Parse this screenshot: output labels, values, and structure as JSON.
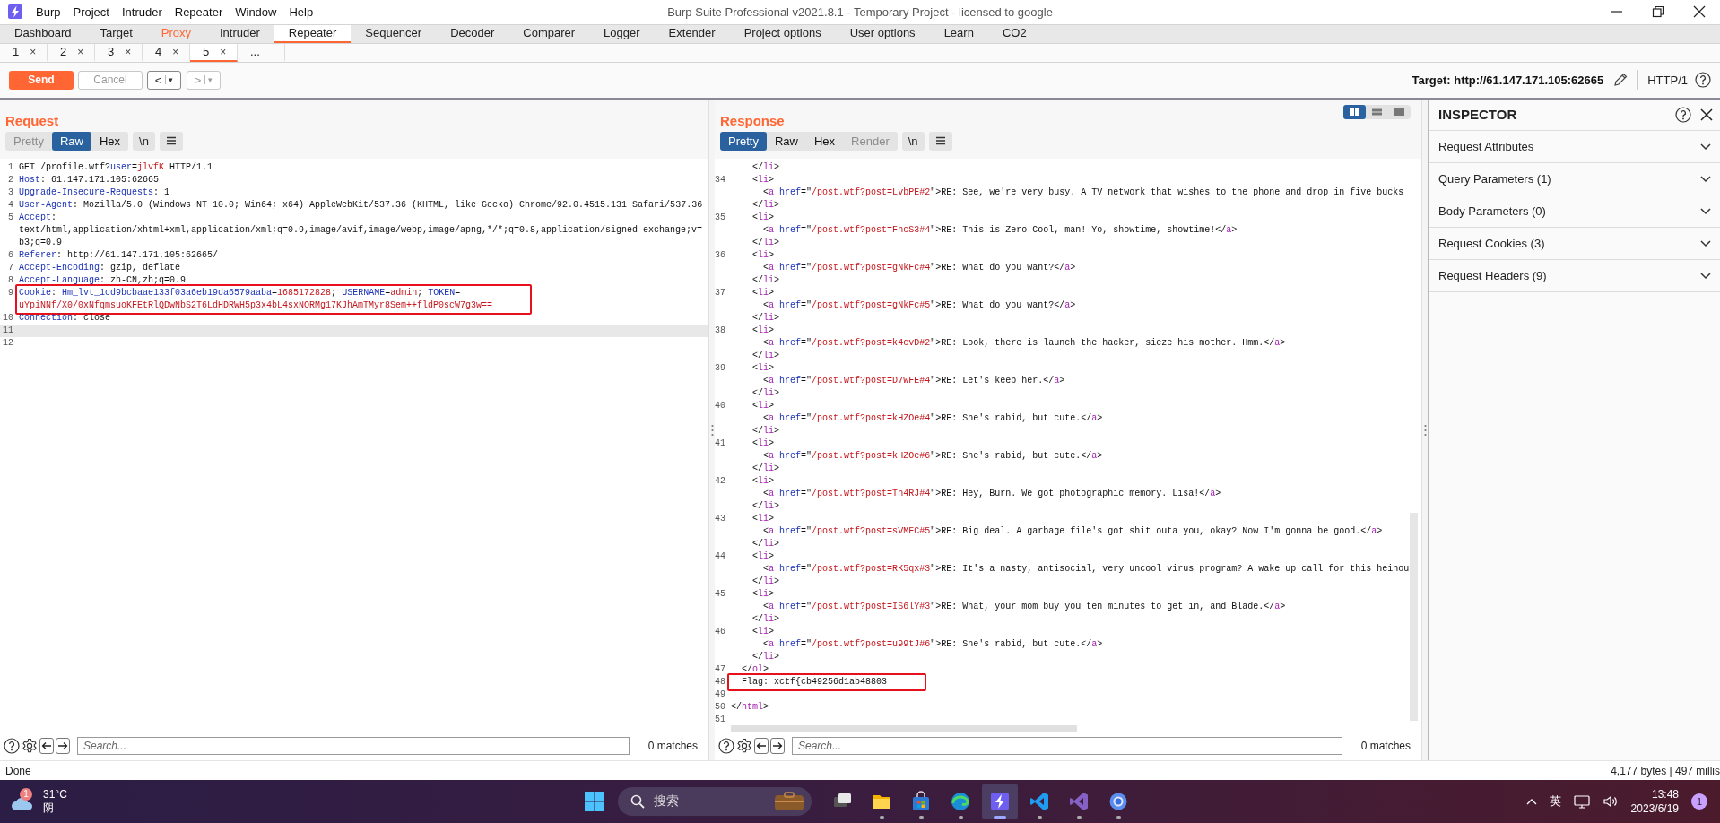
{
  "window": {
    "title": "Burp Suite Professional v2021.8.1 - Temporary Project - licensed to google",
    "menu": [
      "Burp",
      "Project",
      "Intruder",
      "Repeater",
      "Window",
      "Help"
    ]
  },
  "tabs": [
    {
      "label": "Dashboard",
      "selected": false,
      "highlighted": false
    },
    {
      "label": "Target",
      "selected": false,
      "highlighted": false
    },
    {
      "label": "Proxy",
      "selected": false,
      "highlighted": true
    },
    {
      "label": "Intruder",
      "selected": false,
      "highlighted": false
    },
    {
      "label": "Repeater",
      "selected": true,
      "highlighted": false
    },
    {
      "label": "Sequencer",
      "selected": false,
      "highlighted": false
    },
    {
      "label": "Decoder",
      "selected": false,
      "highlighted": false
    },
    {
      "label": "Comparer",
      "selected": false,
      "highlighted": false
    },
    {
      "label": "Logger",
      "selected": false,
      "highlighted": false
    },
    {
      "label": "Extender",
      "selected": false,
      "highlighted": false
    },
    {
      "label": "Project options",
      "selected": false,
      "highlighted": false
    },
    {
      "label": "User options",
      "selected": false,
      "highlighted": false
    },
    {
      "label": "Learn",
      "selected": false,
      "highlighted": false
    },
    {
      "label": "CO2",
      "selected": false,
      "highlighted": false
    }
  ],
  "repeater_tabs": [
    {
      "label": "1",
      "close": "×",
      "selected": false
    },
    {
      "label": "2",
      "close": "×",
      "selected": false
    },
    {
      "label": "3",
      "close": "×",
      "selected": false
    },
    {
      "label": "4",
      "close": "×",
      "selected": false
    },
    {
      "label": "5",
      "close": "×",
      "selected": true
    },
    {
      "label": "...",
      "selected": false
    }
  ],
  "toolbar": {
    "buttons": [
      {
        "kind": "primary",
        "label": "Send",
        "disabled": false
      },
      {
        "kind": "plain",
        "label": "Cancel",
        "disabled": true
      },
      {
        "kind": "history",
        "label": "<",
        "menu": "▾",
        "disabled": false
      },
      {
        "kind": "history",
        "label": ">",
        "menu": "▾",
        "disabled": true
      }
    ],
    "target": "Target: http://61.147.171.105:62665",
    "protocol": "HTTP/1"
  },
  "request": {
    "title": "Request",
    "view_tabs": [
      {
        "label": "Pretty",
        "selected": false,
        "disabled": true
      },
      {
        "label": "Raw",
        "selected": true,
        "disabled": false
      },
      {
        "label": "Hex",
        "selected": false,
        "disabled": false
      }
    ],
    "newline_button": "\\n",
    "lines": [
      {
        "number": "1",
        "current": false,
        "boxed": false,
        "rows": [
          [
            {
              "text": "GET /profile.wtf?",
              "kind": "plain"
            },
            {
              "text": "user",
              "kind": "key"
            },
            {
              "text": "=",
              "kind": "plain"
            },
            {
              "text": "jlvfK",
              "kind": "value"
            },
            {
              "text": " HTTP/1.1",
              "kind": "plain"
            }
          ]
        ]
      },
      {
        "number": "2",
        "current": false,
        "boxed": false,
        "rows": [
          [
            {
              "text": "Host",
              "kind": "key"
            },
            {
              "text": ": 61.147.171.105:62665",
              "kind": "plain"
            }
          ]
        ]
      },
      {
        "number": "3",
        "current": false,
        "boxed": false,
        "rows": [
          [
            {
              "text": "Upgrade-Insecure-Requests",
              "kind": "key"
            },
            {
              "text": ": 1",
              "kind": "plain"
            }
          ]
        ]
      },
      {
        "number": "4",
        "current": false,
        "boxed": false,
        "rows": [
          [
            {
              "text": "User-Agent",
              "kind": "key"
            },
            {
              "text": ": Mozilla/5.0 (Windows NT 10.0; Win64; x64) AppleWebKit/537.36 (KHTML, like Gecko) Chrome/92.0.4515.131 Safari/537.36",
              "kind": "plain"
            }
          ]
        ]
      },
      {
        "number": "5",
        "current": false,
        "boxed": false,
        "rows": [
          [
            {
              "text": "Accept",
              "kind": "key"
            },
            {
              "text": ":",
              "kind": "plain"
            }
          ],
          [
            {
              "text": "text/html,application/xhtml+xml,application/xml;q=0.9,image/avif,image/webp,image/apng,*/*;q=0.8,application/signed-exchange;v=",
              "kind": "plain"
            }
          ],
          [
            {
              "text": "b3;q=0.9",
              "kind": "plain"
            }
          ]
        ]
      },
      {
        "number": "6",
        "current": false,
        "boxed": false,
        "rows": [
          [
            {
              "text": "Referer",
              "kind": "key"
            },
            {
              "text": ": http://61.147.171.105:62665/",
              "kind": "plain"
            }
          ]
        ]
      },
      {
        "number": "7",
        "current": false,
        "boxed": false,
        "rows": [
          [
            {
              "text": "Accept-Encoding",
              "kind": "key"
            },
            {
              "text": ": gzip, deflate",
              "kind": "plain"
            }
          ]
        ]
      },
      {
        "number": "8",
        "current": false,
        "boxed": false,
        "rows": [
          [
            {
              "text": "Accept-Language",
              "kind": "key"
            },
            {
              "text": ": zh-CN,zh;q=0.9",
              "kind": "plain"
            }
          ]
        ]
      },
      {
        "number": "9",
        "current": false,
        "boxed": true,
        "rows": [
          [
            {
              "text": "Cookie",
              "kind": "key"
            },
            {
              "text": ": ",
              "kind": "plain"
            },
            {
              "text": "Hm_lvt_1cd9bcbaae133f03a6eb19da6579aaba",
              "kind": "key"
            },
            {
              "text": "=",
              "kind": "plain"
            },
            {
              "text": "1685172828",
              "kind": "value"
            },
            {
              "text": "; ",
              "kind": "plain"
            },
            {
              "text": "USERNAME",
              "kind": "key"
            },
            {
              "text": "=",
              "kind": "plain"
            },
            {
              "text": "admin",
              "kind": "value"
            },
            {
              "text": "; ",
              "kind": "plain"
            },
            {
              "text": "TOKEN",
              "kind": "key"
            },
            {
              "text": "=",
              "kind": "plain"
            }
          ],
          [
            {
              "text": "uYpiNNf/X0/0xNfqmsuoKFEtRlQDwNbS2T6LdHDRWH5p3x4bL4sxNORMg17KJhAmTMyr8Sem++fldP0scW7g3w==",
              "kind": "value"
            }
          ]
        ]
      },
      {
        "number": "10",
        "current": false,
        "boxed": false,
        "rows": [
          [
            {
              "text": "Connection",
              "kind": "key"
            },
            {
              "text": ": close",
              "kind": "plain"
            }
          ]
        ]
      },
      {
        "number": "11",
        "current": true,
        "boxed": false
      },
      {
        "number": "12",
        "current": false,
        "boxed": false
      }
    ],
    "search": {
      "placeholder": "Search...",
      "matches": "0 matches"
    }
  },
  "response": {
    "title": "Response",
    "layout_buttons": [
      {
        "kind": "split",
        "selected": true
      },
      {
        "kind": "stacked",
        "selected": false
      },
      {
        "kind": "single",
        "selected": false
      }
    ],
    "view_tabs": [
      {
        "label": "Pretty",
        "selected": true,
        "disabled": false
      },
      {
        "label": "Raw",
        "selected": false,
        "disabled": false
      },
      {
        "label": "Hex",
        "selected": false,
        "disabled": false
      },
      {
        "label": "Render",
        "selected": false,
        "disabled": true
      }
    ],
    "newline_button": "\\n",
    "lines": [
      {
        "boxed": false,
        "rows": [
          "    </li>"
        ]
      },
      {
        "number": "34",
        "boxed": false,
        "rows": [
          "    <li>",
          "      <a href=\"/post.wtf?post=LvbPE#2\">RE: See, we're very busy. A TV network that wishes to the phone and drop in five bucks",
          "    </li>"
        ]
      },
      {
        "number": "35",
        "boxed": false,
        "rows": [
          "    <li>",
          "      <a href=\"/post.wtf?post=FhcS3#4\">RE: This is Zero Cool, man! Yo, showtime, showtime!</a>",
          "    </li>"
        ]
      },
      {
        "number": "36",
        "boxed": false,
        "rows": [
          "    <li>",
          "      <a href=\"/post.wtf?post=gNkFc#4\">RE: What do you want?</a>",
          "    </li>"
        ]
      },
      {
        "number": "37",
        "boxed": false,
        "rows": [
          "    <li>",
          "      <a href=\"/post.wtf?post=gNkFc#5\">RE: What do you want?</a>",
          "    </li>"
        ]
      },
      {
        "number": "38",
        "boxed": false,
        "rows": [
          "    <li>",
          "      <a href=\"/post.wtf?post=k4cvD#2\">RE: Look, there is launch the hacker, sieze his mother. Hmm.</a>",
          "    </li>"
        ]
      },
      {
        "number": "39",
        "boxed": false,
        "rows": [
          "    <li>",
          "      <a href=\"/post.wtf?post=D7WFE#4\">RE: Let's keep her.</a>",
          "    </li>"
        ]
      },
      {
        "number": "40",
        "boxed": false,
        "rows": [
          "    <li>",
          "      <a href=\"/post.wtf?post=kHZOe#4\">RE: She's rabid, but cute.</a>",
          "    </li>"
        ]
      },
      {
        "number": "41",
        "boxed": false,
        "rows": [
          "    <li>",
          "      <a href=\"/post.wtf?post=kHZOe#6\">RE: She's rabid, but cute.</a>",
          "    </li>"
        ]
      },
      {
        "number": "42",
        "boxed": false,
        "rows": [
          "    <li>",
          "      <a href=\"/post.wtf?post=Th4RJ#4\">RE: Hey, Burn. We got photographic memory. Lisa!</a>",
          "    </li>"
        ]
      },
      {
        "number": "43",
        "boxed": false,
        "rows": [
          "    <li>",
          "      <a href=\"/post.wtf?post=sVMFC#5\">RE: Big deal. A garbage file's got shit outa you, okay? Now I'm gonna be good.</a>",
          "    </li>"
        ]
      },
      {
        "number": "44",
        "boxed": false,
        "rows": [
          "    <li>",
          "      <a href=\"/post.wtf?post=RK5qx#3\">RE: It's a nasty, antisocial, very uncool virus program? A wake up call for this heinou",
          "    </li>"
        ]
      },
      {
        "number": "45",
        "boxed": false,
        "rows": [
          "    <li>",
          "      <a href=\"/post.wtf?post=IS6lY#3\">RE: What, your mom buy you ten minutes to get in, and Blade.</a>",
          "    </li>"
        ]
      },
      {
        "number": "46",
        "boxed": false,
        "rows": [
          "    <li>",
          "      <a href=\"/post.wtf?post=u99tJ#6\">RE: She's rabid, but cute.</a>",
          "    </li>"
        ]
      },
      {
        "number": "47",
        "boxed": false,
        "rows": [
          "  </ol>"
        ]
      },
      {
        "number": "48",
        "boxed": true,
        "rows": [
          "  Flag: xctf{cb49256d1ab48803"
        ]
      },
      {
        "number": "49",
        "boxed": false
      },
      {
        "number": "50",
        "boxed": false,
        "rows": [
          "</html>"
        ]
      },
      {
        "number": "51",
        "boxed": false
      }
    ],
    "search": {
      "placeholder": "Search...",
      "matches": "0 matches"
    }
  },
  "inspector": {
    "title": "INSPECTOR",
    "sections": [
      {
        "label": "Request Attributes",
        "expanded": false
      },
      {
        "label": "Query Parameters (1)",
        "expanded": false
      },
      {
        "label": "Body Parameters (0)",
        "expanded": false
      },
      {
        "label": "Request Cookies (3)",
        "expanded": false
      },
      {
        "label": "Request Headers (9)",
        "expanded": false
      }
    ]
  },
  "status_bar": {
    "text": "Done",
    "info": "4,177 bytes | 497 millis"
  },
  "taskbar": {
    "weather": {
      "badge": "1",
      "temperature": "31°C",
      "condition": "阴"
    },
    "search": {
      "placeholder": "搜索"
    },
    "apps": [
      {
        "kind": "task-view",
        "running": false,
        "active": false
      },
      {
        "kind": "folder",
        "running": true,
        "active": false
      },
      {
        "kind": "bag",
        "running": true,
        "active": false
      },
      {
        "kind": "swirl",
        "running": true,
        "active": false
      },
      {
        "kind": "bolt",
        "running": true,
        "active": true
      },
      {
        "kind": "ribbon",
        "running": true,
        "active": false
      },
      {
        "kind": "ribbon-violet",
        "running": true,
        "active": false
      },
      {
        "kind": "ring",
        "running": true,
        "active": false
      }
    ],
    "tray": {
      "ime": "英",
      "time": "13:48",
      "date": "2023/6/19",
      "notifications": "1"
    }
  }
}
